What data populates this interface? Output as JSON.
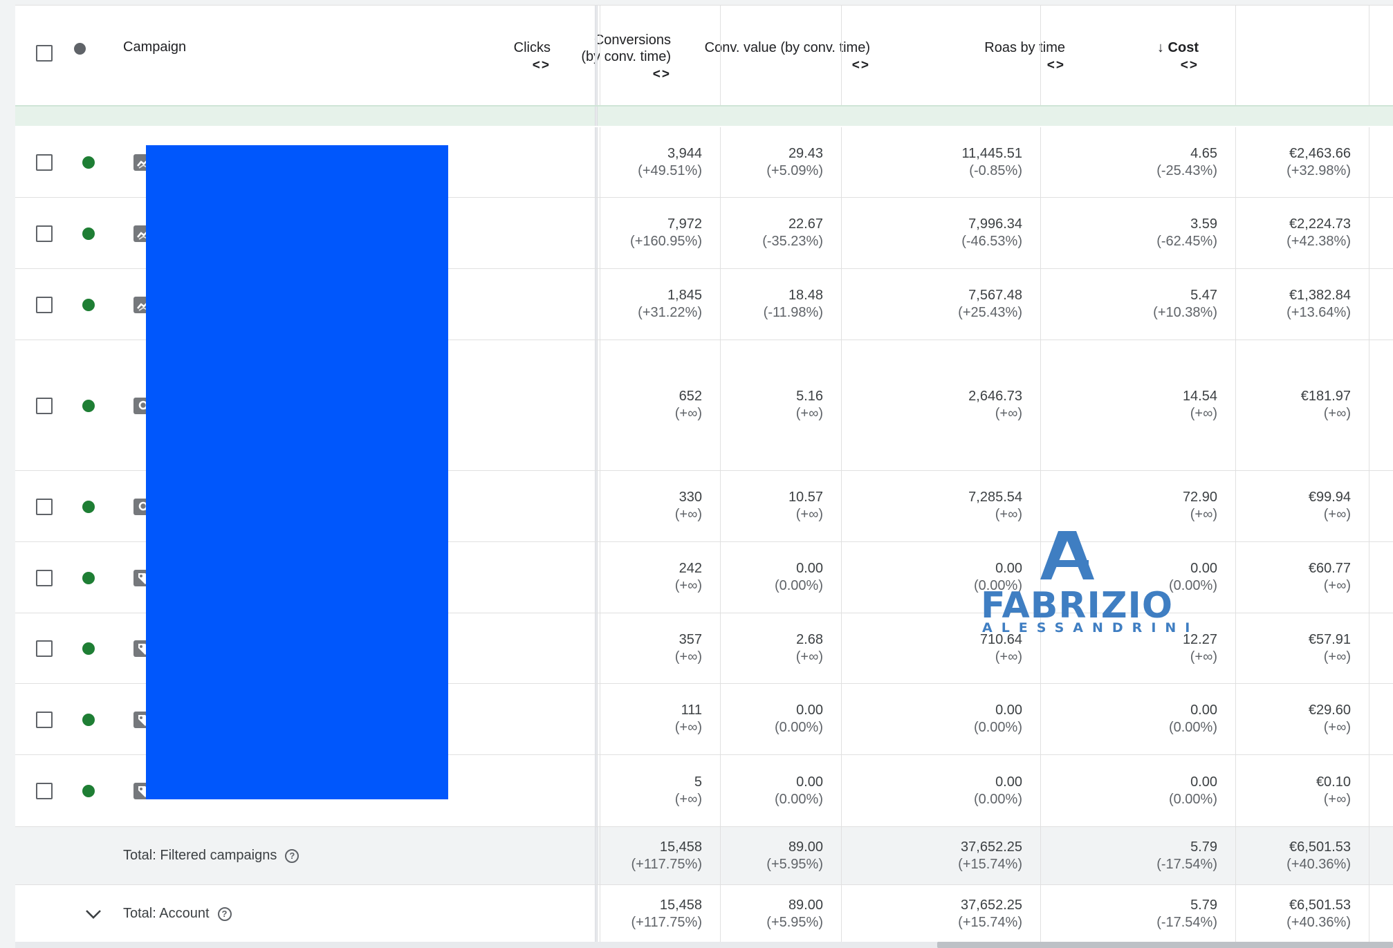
{
  "header": {
    "campaign": "Campaign",
    "clicks": "Clicks",
    "conversions_line1": "Conversions",
    "conversions_line2": "(by conv. time)",
    "conv_value": "Conv. value (by conv. time)",
    "roas": "Roas by time",
    "cost": "Cost",
    "sort_arrows": "<>",
    "sort_down": "↓"
  },
  "rows": [
    {
      "type": "display",
      "clicks": "3,944",
      "clicks_chg": "(+49.51%)",
      "conv": "29.43",
      "conv_chg": "(+5.09%)",
      "value": "11,445.51",
      "value_chg": "(-0.85%)",
      "roas": "4.65",
      "roas_chg": "(-25.43%)",
      "cost": "€2,463.66",
      "cost_chg": "(+32.98%)"
    },
    {
      "type": "display",
      "clicks": "7,972",
      "clicks_chg": "(+160.95%)",
      "conv": "22.67",
      "conv_chg": "(-35.23%)",
      "value": "7,996.34",
      "value_chg": "(-46.53%)",
      "roas": "3.59",
      "roas_chg": "(-62.45%)",
      "cost": "€2,224.73",
      "cost_chg": "(+42.38%)"
    },
    {
      "type": "display",
      "clicks": "1,845",
      "clicks_chg": "(+31.22%)",
      "conv": "18.48",
      "conv_chg": "(-11.98%)",
      "value": "7,567.48",
      "value_chg": "(+25.43%)",
      "roas": "5.47",
      "roas_chg": "(+10.38%)",
      "cost": "€1,382.84",
      "cost_chg": "(+13.64%)"
    },
    {
      "type": "search",
      "clicks": "652",
      "clicks_chg": "(+∞)",
      "conv": "5.16",
      "conv_chg": "(+∞)",
      "value": "2,646.73",
      "value_chg": "(+∞)",
      "roas": "14.54",
      "roas_chg": "(+∞)",
      "cost": "€181.97",
      "cost_chg": "(+∞)"
    },
    {
      "type": "search",
      "clicks": "330",
      "clicks_chg": "(+∞)",
      "conv": "10.57",
      "conv_chg": "(+∞)",
      "value": "7,285.54",
      "value_chg": "(+∞)",
      "roas": "72.90",
      "roas_chg": "(+∞)",
      "cost": "€99.94",
      "cost_chg": "(+∞)"
    },
    {
      "type": "shopping",
      "clicks": "242",
      "clicks_chg": "(+∞)",
      "conv": "0.00",
      "conv_chg": "(0.00%)",
      "value": "0.00",
      "value_chg": "(0.00%)",
      "roas": "0.00",
      "roas_chg": "(0.00%)",
      "cost": "€60.77",
      "cost_chg": "(+∞)"
    },
    {
      "type": "shopping",
      "clicks": "357",
      "clicks_chg": "(+∞)",
      "conv": "2.68",
      "conv_chg": "(+∞)",
      "value": "710.64",
      "value_chg": "(+∞)",
      "roas": "12.27",
      "roas_chg": "(+∞)",
      "cost": "€57.91",
      "cost_chg": "(+∞)"
    },
    {
      "type": "shopping",
      "clicks": "111",
      "clicks_chg": "(+∞)",
      "conv": "0.00",
      "conv_chg": "(0.00%)",
      "value": "0.00",
      "value_chg": "(0.00%)",
      "roas": "0.00",
      "roas_chg": "(0.00%)",
      "cost": "€29.60",
      "cost_chg": "(+∞)"
    },
    {
      "type": "shopping",
      "clicks": "5",
      "clicks_chg": "(+∞)",
      "conv": "0.00",
      "conv_chg": "(0.00%)",
      "value": "0.00",
      "value_chg": "(0.00%)",
      "roas": "0.00",
      "roas_chg": "(0.00%)",
      "cost": "€0.10",
      "cost_chg": "(+∞)"
    }
  ],
  "totals": {
    "filtered": {
      "label": "Total: Filtered campaigns",
      "clicks": "15,458",
      "clicks_chg": "(+117.75%)",
      "conv": "89.00",
      "conv_chg": "(+5.95%)",
      "value": "37,652.25",
      "value_chg": "(+15.74%)",
      "roas": "5.79",
      "roas_chg": "(-17.54%)",
      "cost": "€6,501.53",
      "cost_chg": "(+40.36%)"
    },
    "account": {
      "label": "Total: Account",
      "clicks": "15,458",
      "clicks_chg": "(+117.75%)",
      "conv": "89.00",
      "conv_chg": "(+5.95%)",
      "value": "37,652.25",
      "value_chg": "(+15.74%)",
      "roas": "5.79",
      "roas_chg": "(-17.54%)",
      "cost": "€6,501.53",
      "cost_chg": "(+40.36%)"
    }
  },
  "watermark": {
    "name": "FABRIZIO",
    "sub": "ALESSANDRINI"
  },
  "colors": {
    "status_enabled": "#1e7e34",
    "redaction": "#0057fc",
    "watermark": "#3f7ec2"
  }
}
